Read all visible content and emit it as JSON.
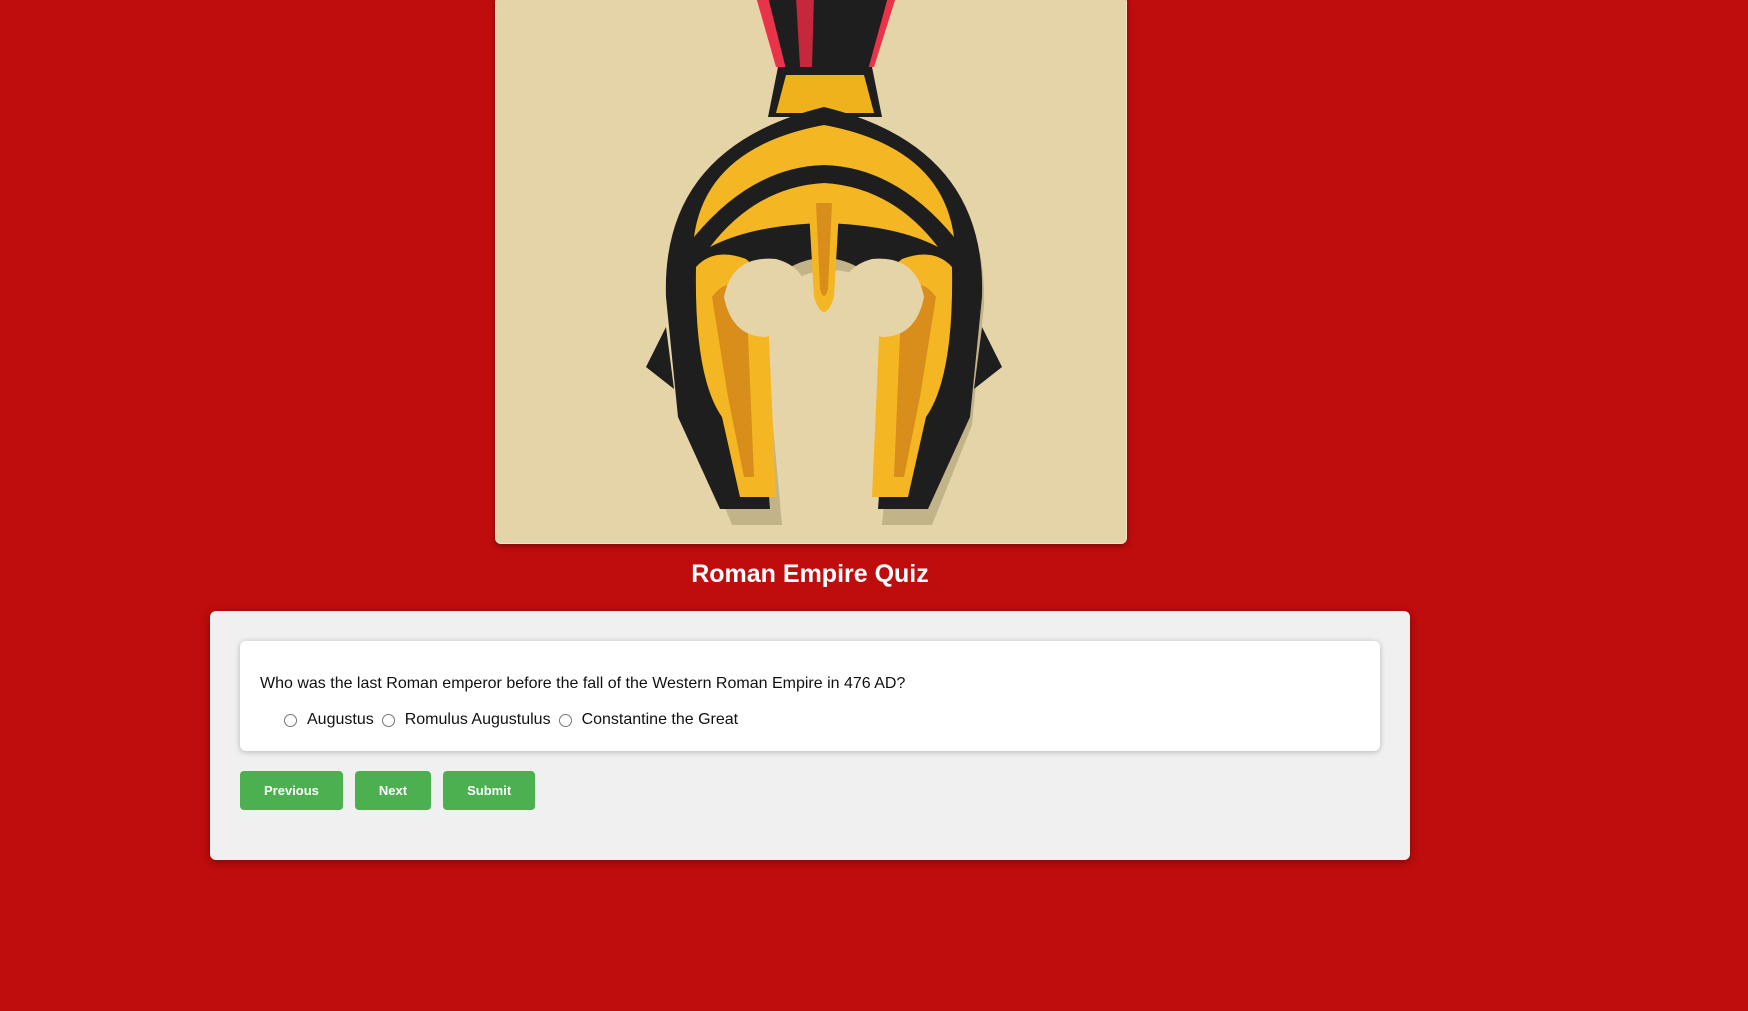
{
  "hero": {
    "image_subject": "roman-helmet"
  },
  "quiz": {
    "title": "Roman Empire Quiz",
    "question": "Who was the last Roman emperor before the fall of the Western Roman Empire in 476 AD?",
    "options": [
      "Augustus",
      "Romulus Augustulus",
      "Constantine the Great"
    ],
    "buttons": {
      "previous": "Previous",
      "next": "Next",
      "submit": "Submit"
    }
  },
  "colors": {
    "background": "#bf0c0c",
    "button": "#4caf50",
    "panel": "#f0f0f0",
    "hero_bg": "#e5d4a7"
  }
}
